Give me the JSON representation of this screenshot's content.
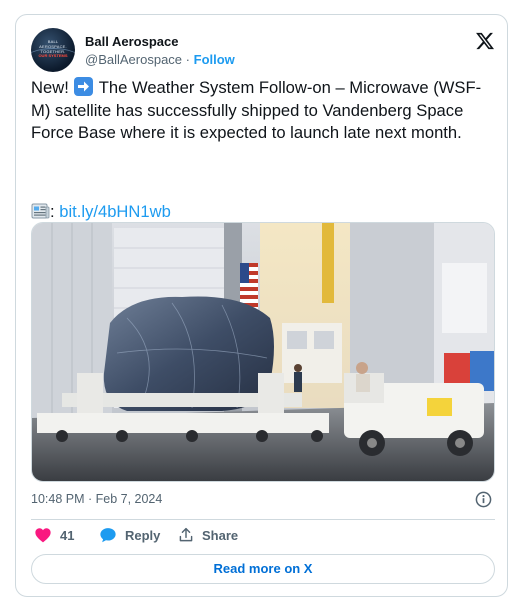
{
  "tweet": {
    "author_name": "Ball Aerospace",
    "handle": "@BallAerospace",
    "separator": "·",
    "follow_label": "Follow",
    "avatar_text_top": "BALL AEROSPACE. TOGETHER.",
    "avatar_text_bottom": "OUR SYSTEMS",
    "text_before_emoji": "New!",
    "text_after_emoji": "The Weather System Follow-on – Microwave (WSF-M) satellite has successfully shipped to Vandenberg Space Force Base where it is expected to launch late next month.",
    "link_prefix": ":",
    "link_text": "bit.ly/4bHN1wb",
    "timestamp": "10:48 PM · Feb 7, 2024",
    "like_count": "41",
    "reply_label": "Reply",
    "share_label": "Share",
    "read_more_label": "Read more on X"
  },
  "icons": {
    "brand": "x-logo-icon",
    "emoji_arrow": "right-arrow-emoji-icon",
    "emoji_news": "newspaper-emoji-icon",
    "like": "heart-icon",
    "reply": "speech-bubble-icon",
    "share": "share-upload-icon",
    "info": "info-icon"
  },
  "colors": {
    "accent": "#1d9bf0",
    "link_button": "#006fd6",
    "heart": "#f91880",
    "text_primary": "#0f1419",
    "text_secondary": "#536471",
    "border": "#cfd9de"
  }
}
